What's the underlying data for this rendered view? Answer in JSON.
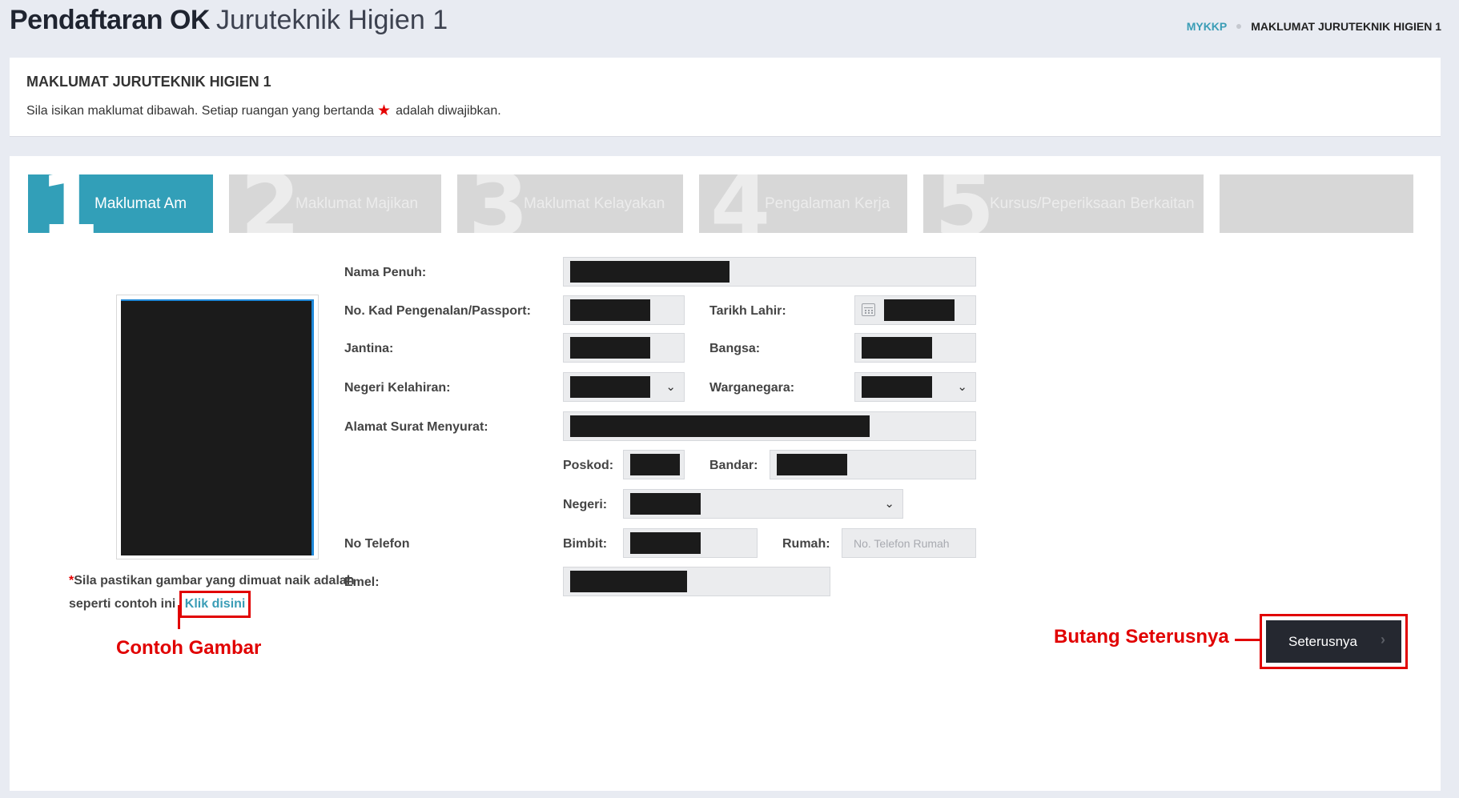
{
  "header": {
    "title_bold": "Pendaftaran OK",
    "title_light": "Juruteknik Higien 1"
  },
  "breadcrumb": {
    "home": "MYKKP",
    "current": "MAKLUMAT JURUTEKNIK HIGIEN 1"
  },
  "info": {
    "title": "MAKLUMAT JURUTEKNIK HIGIEN 1",
    "text_before": "Sila isikan maklumat dibawah. Setiap ruangan yang bertanda",
    "text_after": "adalah diwajibkan."
  },
  "steps": [
    {
      "num": "1",
      "label": "Maklumat Am",
      "active": true
    },
    {
      "num": "2",
      "label": "Maklumat Majikan",
      "active": false
    },
    {
      "num": "3",
      "label": "Maklumat Kelayakan",
      "active": false
    },
    {
      "num": "4",
      "label": "Pengalaman Kerja",
      "active": false
    },
    {
      "num": "5",
      "label": "Kursus/Peperiksaan Berkaitan",
      "active": false
    }
  ],
  "photo_note": {
    "asterisk": "*",
    "text": "Sila pastikan gambar yang dimuat naik adalah seperti contoh ini",
    "link": "Klik disini"
  },
  "annotations": {
    "sample_photo": "Contoh Gambar",
    "next_button": "Butang Seterusnya"
  },
  "form": {
    "full_name_label": "Nama Penuh:",
    "ic_label": "No. Kad Pengenalan/Passport:",
    "dob_label": "Tarikh Lahir:",
    "gender_label": "Jantina:",
    "race_label": "Bangsa:",
    "birth_state_label": "Negeri Kelahiran:",
    "citizenship_label": "Warganegara:",
    "address_label": "Alamat Surat Menyurat:",
    "postcode_label": "Poskod:",
    "city_label": "Bandar:",
    "state_label": "Negeri:",
    "phone_label": "No Telefon",
    "mobile_label": "Bimbit:",
    "home_label": "Rumah:",
    "home_placeholder": "No. Telefon Rumah",
    "email_label": "Emel:"
  },
  "next_button": {
    "label": "Seterusnya",
    "icon": "chevron-right-icon"
  },
  "colors": {
    "accent": "#329fb8",
    "annotation_red": "#e10000",
    "required_star": "#e50000"
  }
}
